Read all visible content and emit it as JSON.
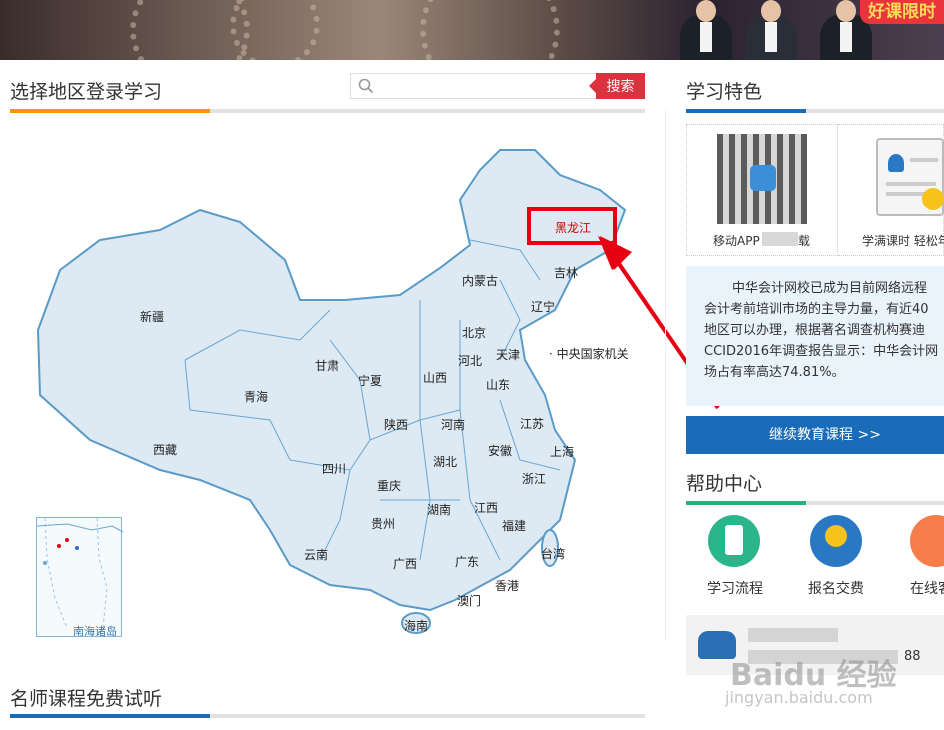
{
  "banner": {
    "promo_text": "好课限时"
  },
  "region_section": {
    "title": "选择地区登录学习",
    "accent_color": "#f39800"
  },
  "search": {
    "placeholder": "",
    "button_label": "搜索"
  },
  "map": {
    "provinces": [
      "新疆",
      "西藏",
      "青海",
      "甘肃",
      "宁夏",
      "内蒙古",
      "黑龙江",
      "吉林",
      "辽宁",
      "北京",
      "天津",
      "河北",
      "山西",
      "山东",
      "陕西",
      "河南",
      "江苏",
      "上海",
      "安徽",
      "湖北",
      "四川",
      "重庆",
      "贵州",
      "湖南",
      "江西",
      "浙江",
      "福建",
      "云南",
      "广西",
      "广东",
      "香港",
      "澳门",
      "台湾",
      "海南"
    ],
    "highlighted": "黑龙江",
    "central_agency": "· 中央国家机关",
    "south_sea_label": "南海诸岛"
  },
  "features": {
    "title": "学习特色",
    "accent_color": "#1b6cb8",
    "app_label": "移动APP",
    "app_label_suffix": "载",
    "cert_label": "学满课时 轻松年"
  },
  "intro": {
    "lines": [
      "中华会计网校已成为目前网络远程",
      "会计考前培训市场的主导力量，有近40",
      "地区可以办理，根据著名调查机构赛迪",
      "CCID2016年调查报告显示：中华会计网",
      "场占有率高达74.81%。"
    ]
  },
  "continue_button": "继续教育课程 >>",
  "help": {
    "title": "帮助中心",
    "accent_color": "#2bae7a",
    "items": [
      "学习流程",
      "报名交费",
      "在线客"
    ]
  },
  "phone": {
    "suffix": "88"
  },
  "watermark": {
    "brand": "Baidu 经验",
    "url": "jingyan.baidu.com"
  },
  "bottom_section": {
    "title": "名师课程免费试听"
  }
}
